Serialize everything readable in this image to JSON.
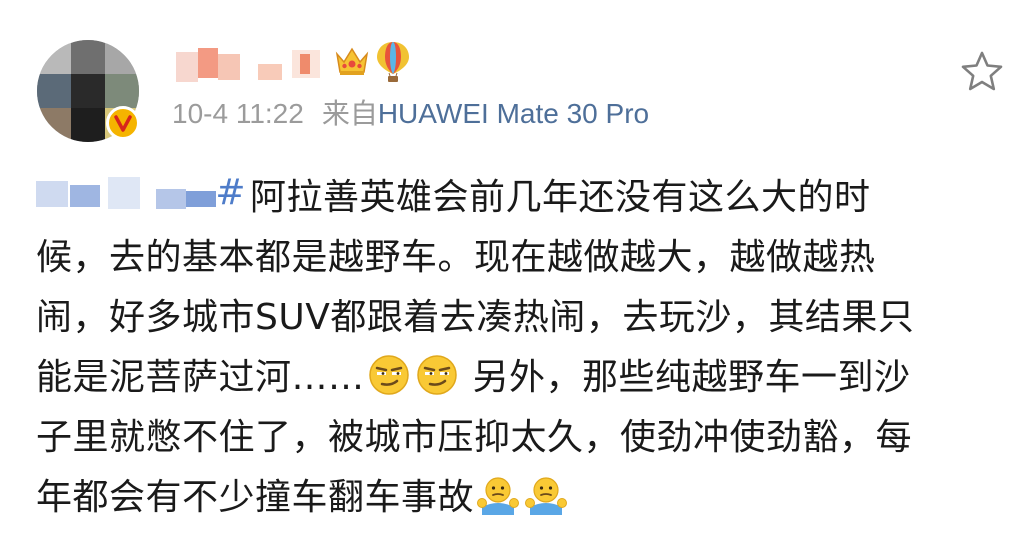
{
  "post": {
    "meta": {
      "time": "10-4 11:22",
      "source_prefix": "来自",
      "device": "HUAWEI Mate 30 Pro"
    },
    "hashtag_suffix": "#",
    "content_lines": [
      "阿拉善英雄会前几年还没有这么大的时",
      "候，去的基本都是越野车。现在越做越大，越做越热",
      "闹，好多城市SUV都跟着去凑热闹，去玩沙，其结果只",
      "能是泥菩萨过河……",
      " 另外，那些纯越野车一到沙",
      "子里就憋不住了，被城市压抑太久，使劲冲使劲豁，每",
      "年都会有不少撞车翻车事故"
    ],
    "icons": {
      "crown": "crown-icon",
      "balloon": "balloon-icon",
      "star": "star-icon",
      "verified": "verified-badge-icon",
      "smirk": "smirk-emoji",
      "shrug": "shrug-emoji"
    },
    "colors": {
      "link_blue": "#4e6f99",
      "hashtag_blue": "#4e7cc9",
      "meta_gray": "#9b9b9b",
      "text": "#1a1a1a",
      "badge_gold": "#f5b400"
    }
  }
}
